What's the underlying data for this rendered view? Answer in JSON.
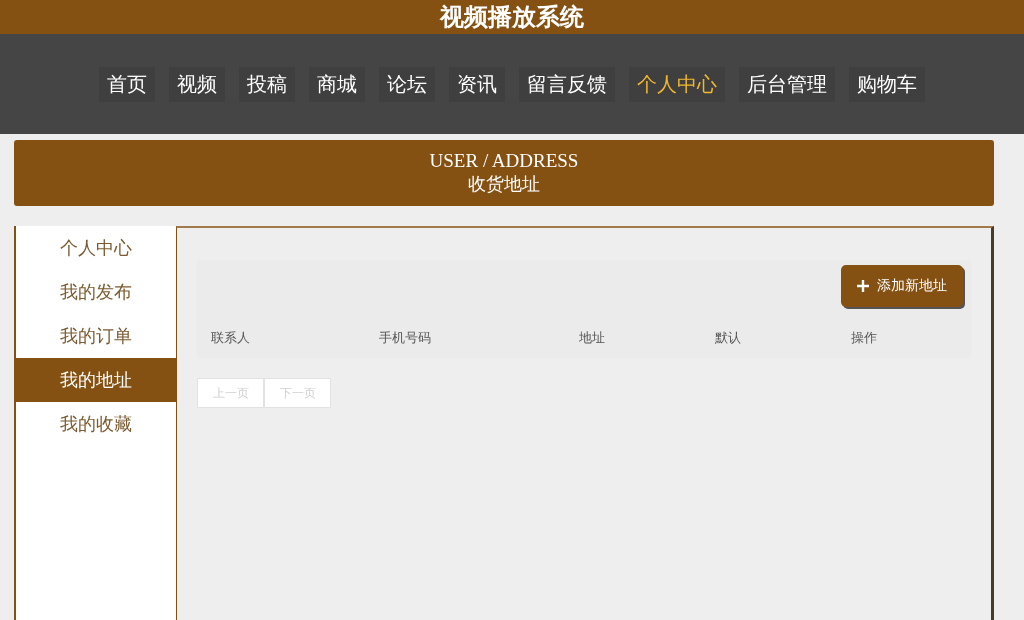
{
  "site_title": "视频播放系统",
  "nav": [
    {
      "label": "首页",
      "selected": false
    },
    {
      "label": "视频",
      "selected": false
    },
    {
      "label": "投稿",
      "selected": false
    },
    {
      "label": "商城",
      "selected": false
    },
    {
      "label": "论坛",
      "selected": false
    },
    {
      "label": "资讯",
      "selected": false
    },
    {
      "label": "留言反馈",
      "selected": false
    },
    {
      "label": "个人中心",
      "selected": true
    },
    {
      "label": "后台管理",
      "selected": false
    },
    {
      "label": "购物车",
      "selected": false
    }
  ],
  "banner": {
    "title": "USER / ADDRESS",
    "subtitle": "收货地址"
  },
  "sidebar": {
    "items": [
      {
        "label": "个人中心",
        "selected": false
      },
      {
        "label": "我的发布",
        "selected": false
      },
      {
        "label": "我的订单",
        "selected": false
      },
      {
        "label": "我的地址",
        "selected": true
      },
      {
        "label": "我的收藏",
        "selected": false
      }
    ]
  },
  "add_button": "添加新地址",
  "table": {
    "columns": [
      "联系人",
      "手机号码",
      "地址",
      "默认",
      "操作"
    ]
  },
  "pagination": [
    {
      "label": "上一页",
      "disabled": true
    },
    {
      "label": "下一页",
      "disabled": true
    }
  ]
}
